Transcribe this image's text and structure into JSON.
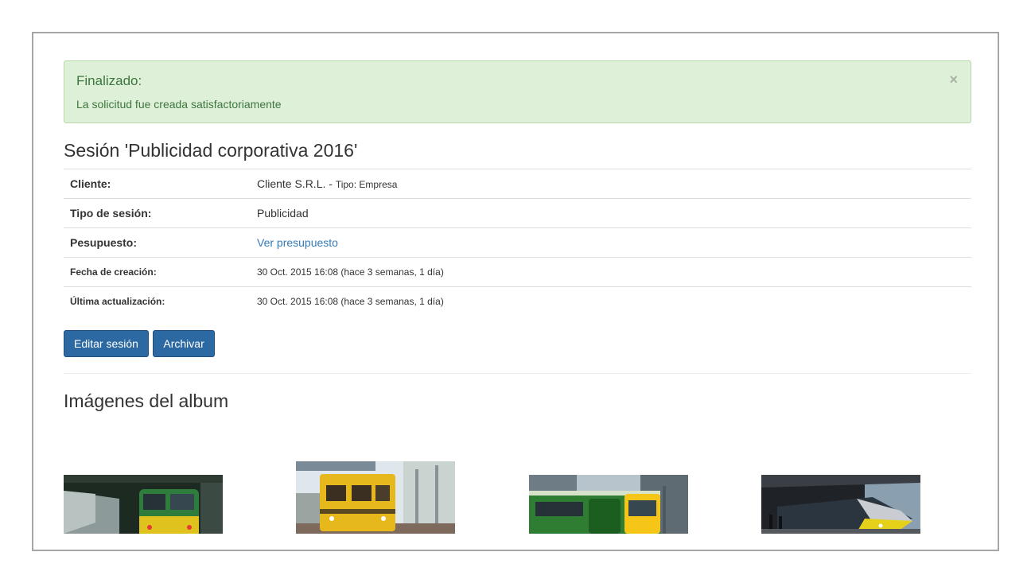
{
  "alert": {
    "title": "Finalizado:",
    "message": "La solicitud fue creada satisfactoriamente",
    "close": "×"
  },
  "session": {
    "title": "Sesión 'Publicidad corporativa 2016'"
  },
  "details": {
    "cliente_label": "Cliente:",
    "cliente_value": "Cliente S.R.L. -",
    "cliente_tipo": "Tipo: Empresa",
    "tipo_label": "Tipo de sesión:",
    "tipo_value": "Publicidad",
    "presupuesto_label": "Pesupuesto:",
    "presupuesto_link": "Ver presupuesto",
    "fecha_label": "Fecha de creación:",
    "fecha_value": "30 Oct. 2015 16:08 (hace 3 semanas, 1 día)",
    "actualizacion_label": "Última actualización:",
    "actualizacion_value": "30 Oct. 2015 16:08 (hace 3 semanas, 1 día)"
  },
  "actions": {
    "edit": "Editar sesión",
    "archive": "Archivar"
  },
  "album": {
    "title": "Imágenes del album"
  },
  "colors": {
    "alert_bg": "#dff0d8",
    "alert_text": "#3c763d",
    "link": "#337ab7",
    "button": "#2c68a1"
  }
}
